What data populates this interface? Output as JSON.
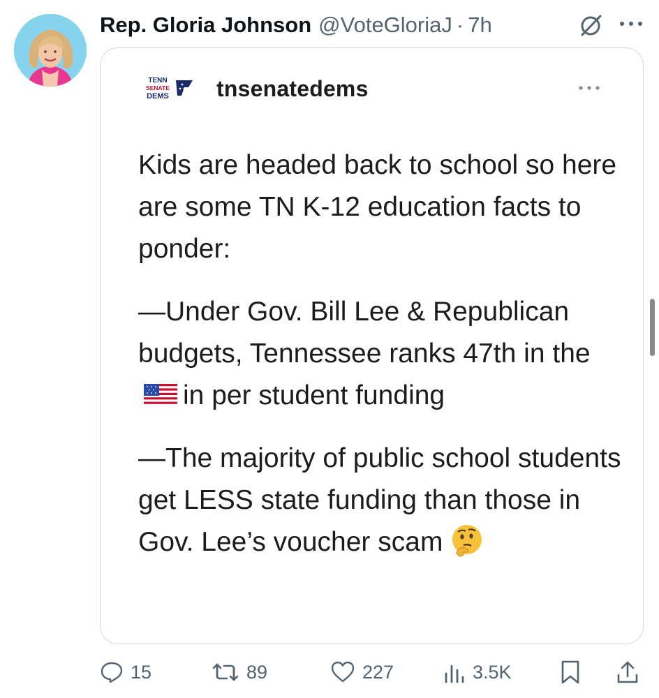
{
  "author": {
    "display_name": "Rep. Gloria Johnson",
    "handle": "@VoteGloriaJ",
    "separator": "·",
    "timestamp": "7h"
  },
  "icons": {
    "grok": "grok-icon",
    "more": "more-icon"
  },
  "quoted_post": {
    "logo_lines": [
      "TENN",
      "SENATE",
      "DEMS"
    ],
    "account": "tnsenatedems",
    "paragraphs": [
      {
        "segments": [
          "Kids are headed back to school so here are some TN K-12 education facts to ponder:"
        ]
      },
      {
        "before_flag": "—Under Gov. Bill Lee & Republican budgets, Tennessee ranks 47th in the",
        "after_flag": "in per student funding"
      },
      {
        "before_emoji": "—The majority of public school students get LESS state funding than those in Gov. Lee’s voucher scam"
      }
    ]
  },
  "actions": {
    "replies": "15",
    "reposts": "89",
    "likes": "227",
    "views": "3.5K"
  },
  "colors": {
    "text": "#0f1419",
    "muted": "#536471",
    "border": "#cfd9de",
    "logo_navy": "#1a2a6c",
    "logo_red": "#c8102e"
  }
}
